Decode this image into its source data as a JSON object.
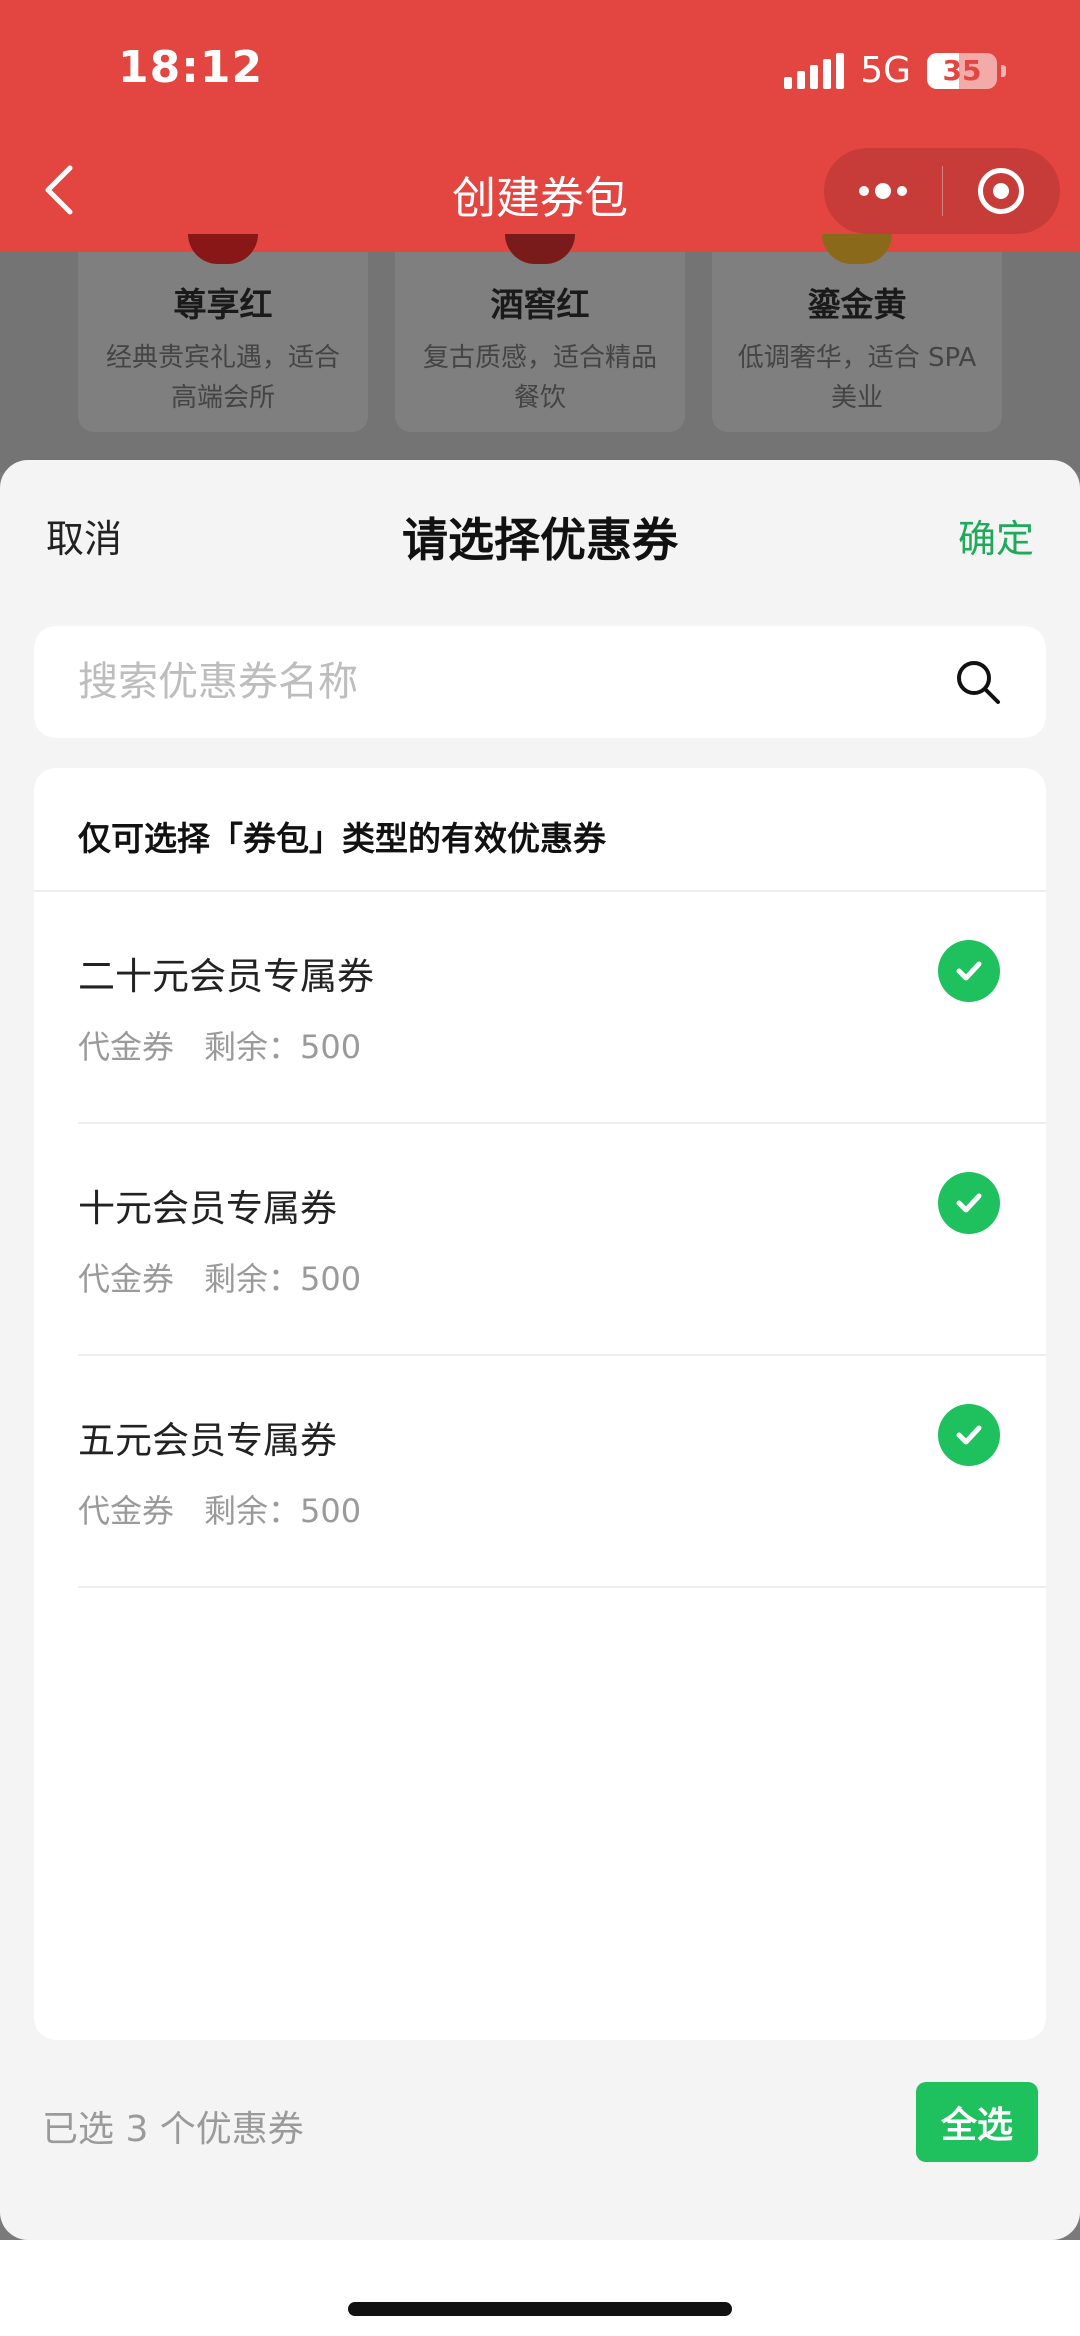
{
  "status_bar": {
    "time": "18:12",
    "network": "5G",
    "battery": "35"
  },
  "nav": {
    "title": "创建券包"
  },
  "themes": [
    {
      "name": "尊享红",
      "desc": "经典贵宾礼遇，适合高端会所",
      "color": "#8a1717"
    },
    {
      "name": "酒窖红",
      "desc": "复古质感，适合精品餐饮",
      "color": "#7a1b1b"
    },
    {
      "name": "鎏金黄",
      "desc": "低调奢华，适合 SPA 美业",
      "color": "#8a6a1a"
    }
  ],
  "sheet": {
    "cancel_label": "取消",
    "title": "请选择优惠券",
    "confirm_label": "确定",
    "search_placeholder": "搜索优惠券名称",
    "notice": "仅可选择「券包」类型的有效优惠券",
    "items": [
      {
        "name": "二十元会员专属券",
        "type": "代金券",
        "remaining": "剩余：500",
        "checked": true
      },
      {
        "name": "十元会员专属券",
        "type": "代金券",
        "remaining": "剩余：500",
        "checked": true
      },
      {
        "name": "五元会员专属券",
        "type": "代金券",
        "remaining": "剩余：500",
        "checked": true
      }
    ],
    "selected_count_text": "已选 3 个优惠券",
    "select_all_label": "全选"
  },
  "colors": {
    "header": "#e34541",
    "accent_green": "#1fc05e",
    "confirm_green": "#1eaa5a"
  }
}
